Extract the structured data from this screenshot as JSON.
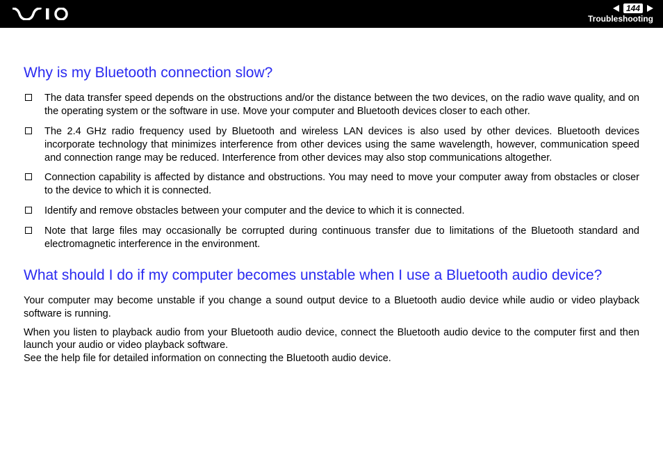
{
  "header": {
    "page_number": "144",
    "section_label": "Troubleshooting",
    "logo_alt": "VAIO"
  },
  "section1": {
    "heading": "Why is my Bluetooth connection slow?",
    "bullets": [
      "The data transfer speed depends on the obstructions and/or the distance between the two devices, on the radio wave quality, and on the operating system or the software in use. Move your computer and Bluetooth devices closer to each other.",
      "The 2.4 GHz radio frequency used by Bluetooth and wireless LAN devices is also used by other devices. Bluetooth devices incorporate technology that minimizes interference from other devices using the same wavelength, however, communication speed and connection range may be reduced. Interference from other devices may also stop communications altogether.",
      "Connection capability is affected by distance and obstructions. You may need to move your computer away from obstacles or closer to the device to which it is connected.",
      "Identify and remove obstacles between your computer and the device to which it is connected.",
      "Note that large files may occasionally be corrupted during continuous transfer due to limitations of the Bluetooth standard and electromagnetic interference in the environment."
    ]
  },
  "section2": {
    "heading": "What should I do if my computer becomes unstable when I use a Bluetooth audio device?",
    "paragraphs": [
      "Your computer may become unstable if you change a sound output device to a Bluetooth audio device while audio or video playback software is running.",
      "When you listen to playback audio from your Bluetooth audio device, connect the Bluetooth audio device to the computer first and then launch your audio or video playback software.\nSee the help file for detailed information on connecting the Bluetooth audio device."
    ]
  }
}
